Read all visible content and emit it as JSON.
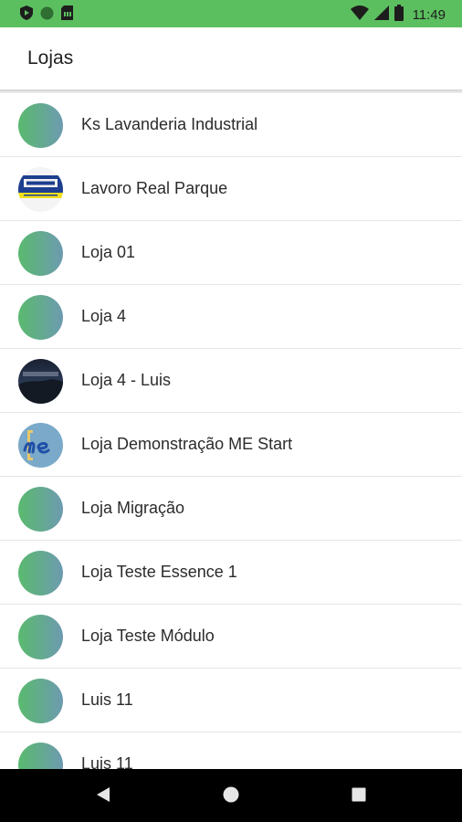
{
  "status_bar": {
    "time": "11:49",
    "background": "#5cbf5f",
    "left_icons": [
      "shield-icon",
      "circle-icon",
      "sim-card-icon"
    ],
    "right_icons": [
      "wifi-icon",
      "cell-signal-icon",
      "battery-icon"
    ]
  },
  "app_bar": {
    "title": "Lojas"
  },
  "stores": [
    {
      "name": "Ks Lavanderia Industrial",
      "avatar": "gradient"
    },
    {
      "name": "Lavoro Real Parque",
      "avatar": "logo-lavoro"
    },
    {
      "name": "Loja 01",
      "avatar": "gradient"
    },
    {
      "name": "Loja 4",
      "avatar": "gradient"
    },
    {
      "name": "Loja 4 - Luis",
      "avatar": "photo-dark"
    },
    {
      "name": "Loja Demonstração ME Start",
      "avatar": "logo-me"
    },
    {
      "name": "Loja Migração",
      "avatar": "gradient"
    },
    {
      "name": "Loja Teste Essence 1",
      "avatar": "gradient"
    },
    {
      "name": "Loja Teste Módulo",
      "avatar": "gradient"
    },
    {
      "name": "Luis 11",
      "avatar": "gradient"
    },
    {
      "name": "Luis 11",
      "avatar": "gradient"
    }
  ],
  "nav_bar": {
    "buttons": [
      "back-icon",
      "home-icon",
      "recents-icon"
    ]
  }
}
